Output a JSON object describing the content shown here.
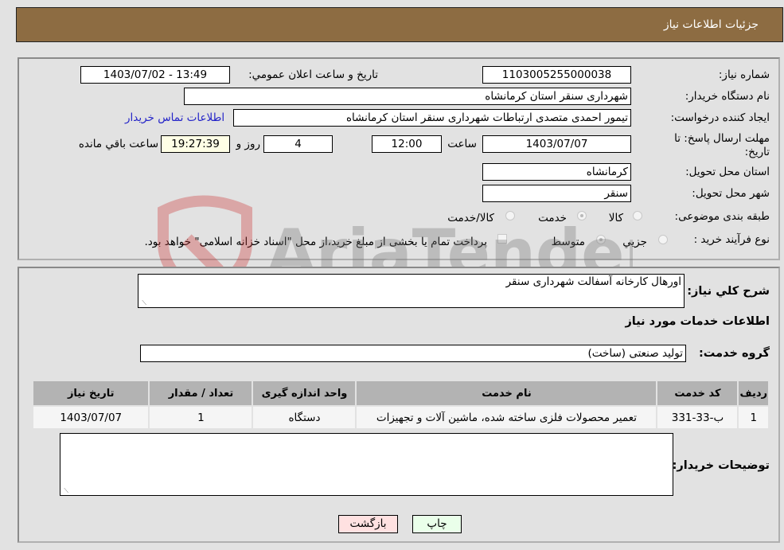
{
  "header": {
    "title": "جزئیات اطلاعات نیاز"
  },
  "form": {
    "need_number_label": "شماره نیاز:",
    "need_number": "1103005255000038",
    "announce_label": "تاریخ و ساعت اعلان عمومي:",
    "announce_value": "1403/07/02 - 13:49",
    "buyer_org_label": "نام دستگاه خریدار:",
    "buyer_org": "شهرداری سنقر استان کرمانشاه",
    "creator_label": "ایجاد کننده درخواست:",
    "creator": "تیمور احمدی متصدی ارتباطات شهرداری سنقر استان کرمانشاه",
    "contact_link": "اطلاعات تماس خریدار",
    "deadline_label": "مهلت ارسال پاسخ: تا تاریخ:",
    "deadline_date": "1403/07/07",
    "time_label": "ساعت",
    "deadline_time": "12:00",
    "days_value": "4",
    "days_label": "روز و",
    "remaining_time": "19:27:39",
    "remaining_label": "ساعت باقي مانده",
    "province_label": "استان محل تحویل:",
    "province": "کرمانشاه",
    "city_label": "شهر محل تحویل:",
    "city": "سنقر",
    "category_label": "طبقه بندی موضوعی:",
    "category_options": [
      {
        "label": "کالا",
        "selected": false
      },
      {
        "label": "خدمت",
        "selected": true
      },
      {
        "label": "کالا/خدمت",
        "selected": false
      }
    ],
    "process_label": "نوع فرآیند خرید :",
    "process_options": [
      {
        "label": "جزيي",
        "selected": false
      },
      {
        "label": "متوسط",
        "selected": true
      }
    ],
    "treasury_note": "پرداخت تمام یا بخشی از مبلغ خرید،از محل \"اسناد خزانه اسلامی\" خواهد بود."
  },
  "details": {
    "description_label": "شرح كلي نياز:",
    "description": "اورهال کارخانه آسفالت شهرداری سنقر",
    "services_heading": "اطلاعات خدمات مورد نیاز",
    "service_group_label": "گروه خدمت:",
    "service_group": "تولید صنعتی (ساخت)",
    "table": {
      "headers": [
        "ردیف",
        "کد خدمت",
        "نام خدمت",
        "واحد اندازه گیری",
        "تعداد / مقدار",
        "تاریخ نیاز"
      ],
      "rows": [
        [
          "1",
          "ب-33-331",
          "تعمیر محصولات فلزی ساخته شده، ماشین آلات و تجهیزات",
          "دستگاه",
          "1",
          "1403/07/07"
        ]
      ]
    },
    "buyer_notes_label": "توضیحات خریدار:",
    "buyer_notes": ""
  },
  "buttons": {
    "print": "چاپ",
    "back": "بازگشت"
  },
  "watermark": "AriaTender.neT",
  "colors": {
    "header_bg": "#8d6c42",
    "print_bg": "#eaffea",
    "back_bg": "#ffe1e1",
    "link": "#2323c8"
  }
}
